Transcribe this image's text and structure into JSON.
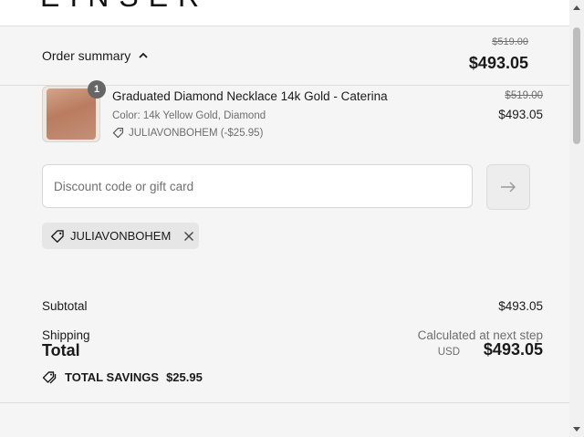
{
  "brand": {
    "logo_text": "EINSER"
  },
  "summary": {
    "toggle_label": "Order summary",
    "compare_total": "$519.00",
    "total": "$493.05"
  },
  "line_item": {
    "quantity": "1",
    "name": "Graduated Diamond Necklace 14k Gold - Caterina",
    "variant": "Color: 14k Yellow Gold, Diamond",
    "discount": "JULIAVONBOHEM (-$25.95)",
    "compare_price": "$519.00",
    "price": "$493.05"
  },
  "discount_field": {
    "placeholder": "Discount code or gift card",
    "value": ""
  },
  "applied_code": {
    "code": "JULIAVONBOHEM"
  },
  "totals": {
    "subtotal_label": "Subtotal",
    "subtotal_value": "$493.05",
    "shipping_label": "Shipping",
    "shipping_value": "Calculated at next step",
    "total_label": "Total",
    "currency": "USD",
    "total_value": "$493.05",
    "savings_label": "TOTAL SAVINGS",
    "savings_value": "$25.95"
  },
  "icons": {
    "toggle": "chevron-up-icon",
    "discount_tag": "tag-icon",
    "apply": "arrow-right-icon",
    "remove": "close-icon",
    "savings": "tags-icon"
  }
}
